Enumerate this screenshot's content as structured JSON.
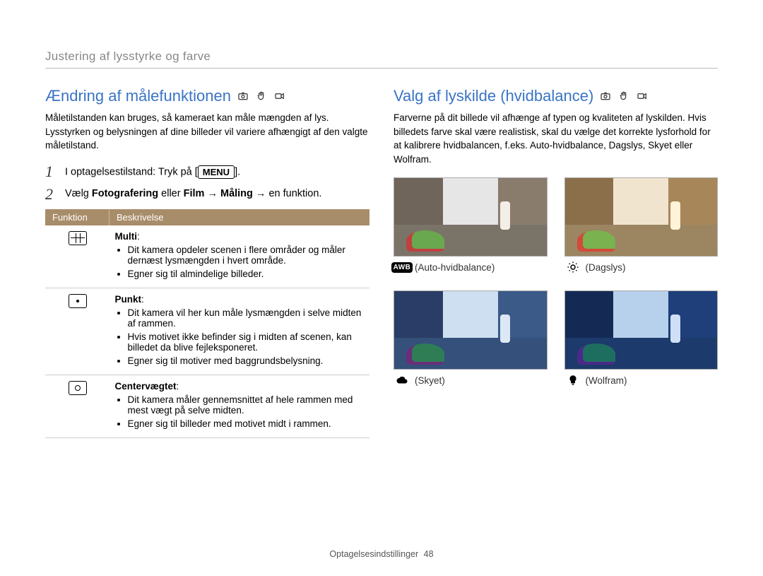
{
  "breadcrumb": "Justering af lysstyrke og farve",
  "left": {
    "title": "Ændring af målefunktionen",
    "intro": "Måletilstanden kan bruges, så kameraet kan måle mængden af lys. Lysstyrken og belysningen af dine billeder vil variere afhængigt af den valgte måletilstand.",
    "step1_pre": "I optagelsestilstand: Tryk på [",
    "step1_menu": "MENU",
    "step1_post": "].",
    "step2_pre": "Vælg ",
    "step2_bold1": "Fotografering",
    "step2_mid1": " eller ",
    "step2_bold2": "Film",
    "step2_arrow1": " → ",
    "step2_bold3": "Måling",
    "step2_arrow2": " → en funktion.",
    "table": {
      "h1": "Funktion",
      "h2": "Beskrivelse",
      "rows": [
        {
          "name": "Multi",
          "bullets": [
            "Dit kamera opdeler scenen i flere områder og måler dernæst lysmængden i hvert område.",
            "Egner sig til almindelige billeder."
          ]
        },
        {
          "name": "Punkt",
          "bullets": [
            "Dit kamera vil her kun måle lysmængden i selve midten af rammen.",
            "Hvis motivet ikke befinder sig i midten af scenen, kan billedet da blive fejleksponeret.",
            "Egner sig til motiver med baggrundsbelysning."
          ]
        },
        {
          "name": "Centervægtet",
          "bullets": [
            "Dit kamera måler gennemsnittet af hele rammen med mest vægt på selve midten.",
            "Egner sig til billeder med motivet midt i rammen."
          ]
        }
      ]
    }
  },
  "right": {
    "title": "Valg af lyskilde (hvidbalance)",
    "intro": "Farverne på dit billede vil afhænge af typen og kvaliteten af lyskilden. Hvis billedets farve skal være realistisk, skal du vælge det korrekte lysforhold for at kalibrere hvidbalancen, f.eks. Auto-hvidbalance, Dagslys, Skyet eller Wolfram.",
    "thumbs": [
      {
        "caption": "(Auto-hvidbalance)",
        "icon": "awb",
        "cls": "wb-auto"
      },
      {
        "caption": "(Dagslys)",
        "icon": "sun",
        "cls": "wb-day"
      },
      {
        "caption": "(Skyet)",
        "icon": "cloud",
        "cls": "wb-cloud"
      },
      {
        "caption": "(Wolfram)",
        "icon": "bulb",
        "cls": "wb-tung"
      }
    ],
    "awb_label": "AWB"
  },
  "footer": {
    "section": "Optagelsesindstillinger",
    "page": "48"
  }
}
